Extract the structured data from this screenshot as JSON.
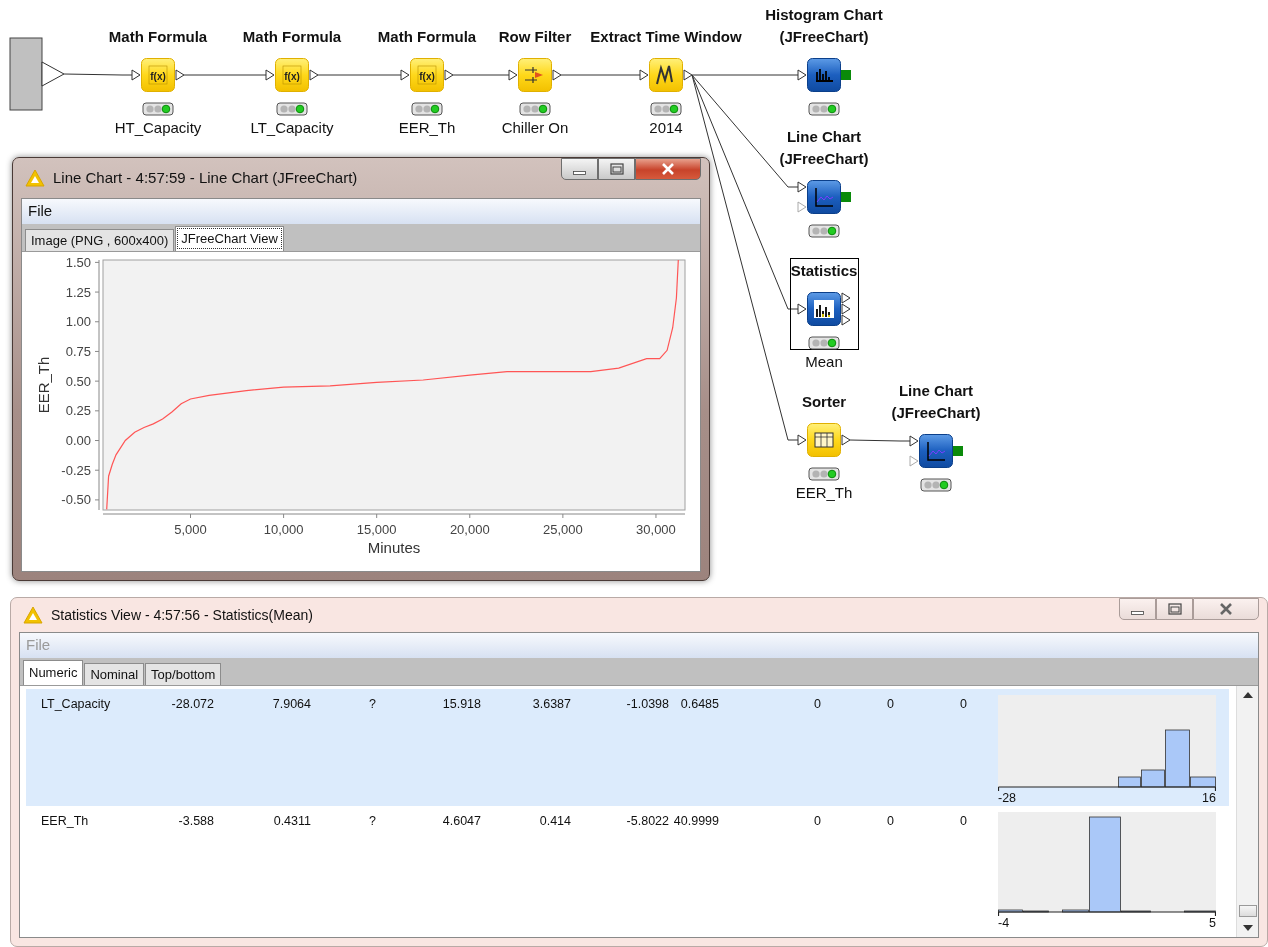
{
  "workflow": {
    "nodes": [
      {
        "kind": "source",
        "selected": false
      },
      {
        "kind": "formula",
        "title": "Math Formula",
        "icon_label": "f(x)",
        "annotation": "HT_Capacity",
        "executed": true,
        "selected": false
      },
      {
        "kind": "formula",
        "title": "Math Formula",
        "icon_label": "f(x)",
        "annotation": "LT_Capacity",
        "executed": true,
        "selected": false
      },
      {
        "kind": "formula",
        "title": "Math Formula",
        "icon_label": "f(x)",
        "annotation": "EER_Th",
        "executed": true,
        "selected": false
      },
      {
        "kind": "filter",
        "title": "Row Filter",
        "annotation": "Chiller On",
        "executed": true,
        "selected": false
      },
      {
        "kind": "timewindow",
        "title": "Extract Time Window",
        "annotation": "2014",
        "executed": true,
        "selected": false
      },
      {
        "kind": "histogram",
        "title": "Histogram Chart (JFreeChart)",
        "executed": true,
        "selected": false
      },
      {
        "kind": "linechart",
        "title": "Line Chart (JFreeChart)",
        "executed": true,
        "selected": false
      },
      {
        "kind": "statistics",
        "title": "Statistics",
        "annotation": "Mean",
        "executed": true,
        "selected": true
      },
      {
        "kind": "sorter",
        "title": "Sorter",
        "annotation": "EER_Th",
        "executed": true,
        "selected": false
      },
      {
        "kind": "linechart",
        "title": "Line Chart (JFreeChart)",
        "executed": true,
        "selected": false
      }
    ]
  },
  "windows": [
    {
      "kind": "chart",
      "title": "Line Chart - 4:57:59 - Line Chart (JFreeChart)",
      "active": true,
      "menu": [
        "File"
      ],
      "tabs": [
        {
          "label": "Image (PNG , 600x400)",
          "selected": false
        },
        {
          "label": "JFreeChart View",
          "selected": true
        }
      ],
      "chart_data": {
        "type": "line",
        "xlabel": "Minutes",
        "ylabel": "EER_Th",
        "xlim": [
          300,
          31560
        ],
        "ylim": [
          -0.585,
          1.52
        ],
        "xticks": [
          {
            "value": 5000,
            "label": "5,000"
          },
          {
            "value": 10000,
            "label": "10,000"
          },
          {
            "value": 15000,
            "label": "15,000"
          },
          {
            "value": 20000,
            "label": "20,000"
          },
          {
            "value": 25000,
            "label": "25,000"
          },
          {
            "value": 30000,
            "label": "30,000"
          }
        ],
        "yticks": [
          {
            "value": 1.5,
            "label": "1.50"
          },
          {
            "value": 1.25,
            "label": "1.25"
          },
          {
            "value": 1.0,
            "label": "1.00"
          },
          {
            "value": 0.75,
            "label": "0.75"
          },
          {
            "value": 0.5,
            "label": "0.50"
          },
          {
            "value": 0.25,
            "label": "0.25"
          },
          {
            "value": 0.0,
            "label": "0.00"
          },
          {
            "value": -0.25,
            "label": "-0.25"
          },
          {
            "value": -0.5,
            "label": "-0.50"
          }
        ],
        "x": [
          500,
          600,
          800,
          1000,
          1500,
          2000,
          2500,
          3000,
          3500,
          4000,
          4500,
          5000,
          6000,
          8000,
          10000,
          12500,
          15000,
          17500,
          20000,
          22000,
          24000,
          26500,
          28000,
          29500,
          30200,
          30600,
          30900,
          31100,
          31200
        ],
        "series": [
          {
            "color": "#ff5555",
            "values": [
              -0.58,
              -0.3,
              -0.2,
              -0.12,
              0.0,
              0.07,
              0.11,
              0.14,
              0.18,
              0.24,
              0.31,
              0.35,
              0.38,
              0.42,
              0.45,
              0.46,
              0.49,
              0.51,
              0.55,
              0.58,
              0.58,
              0.58,
              0.61,
              0.69,
              0.69,
              0.76,
              0.95,
              1.2,
              1.52
            ]
          }
        ]
      }
    },
    {
      "kind": "statistics",
      "title": "Statistics View - 4:57:56 - Statistics(Mean)",
      "active": false,
      "menu": [
        "File"
      ],
      "tabs": [
        {
          "label": "Numeric",
          "selected": true
        },
        {
          "label": "Nominal",
          "selected": false
        },
        {
          "label": "Top/bottom",
          "selected": false
        }
      ],
      "rows": [
        {
          "name": "LT_Capacity",
          "values": [
            "-28.072",
            "7.9064",
            "?",
            "15.918",
            "3.6387",
            "-1.0398",
            "0.6485",
            "0",
            "0",
            "0"
          ],
          "histogram": {
            "min_label": "-28",
            "max_label": "16"
          },
          "selected": true
        },
        {
          "name": "EER_Th",
          "values": [
            "-3.588",
            "0.4311",
            "?",
            "4.6047",
            "0.414",
            "-5.8022",
            "40.9999",
            "0",
            "0",
            "0"
          ],
          "histogram": {
            "min_label": "-4",
            "max_label": "5"
          },
          "selected": false
        }
      ]
    }
  ]
}
